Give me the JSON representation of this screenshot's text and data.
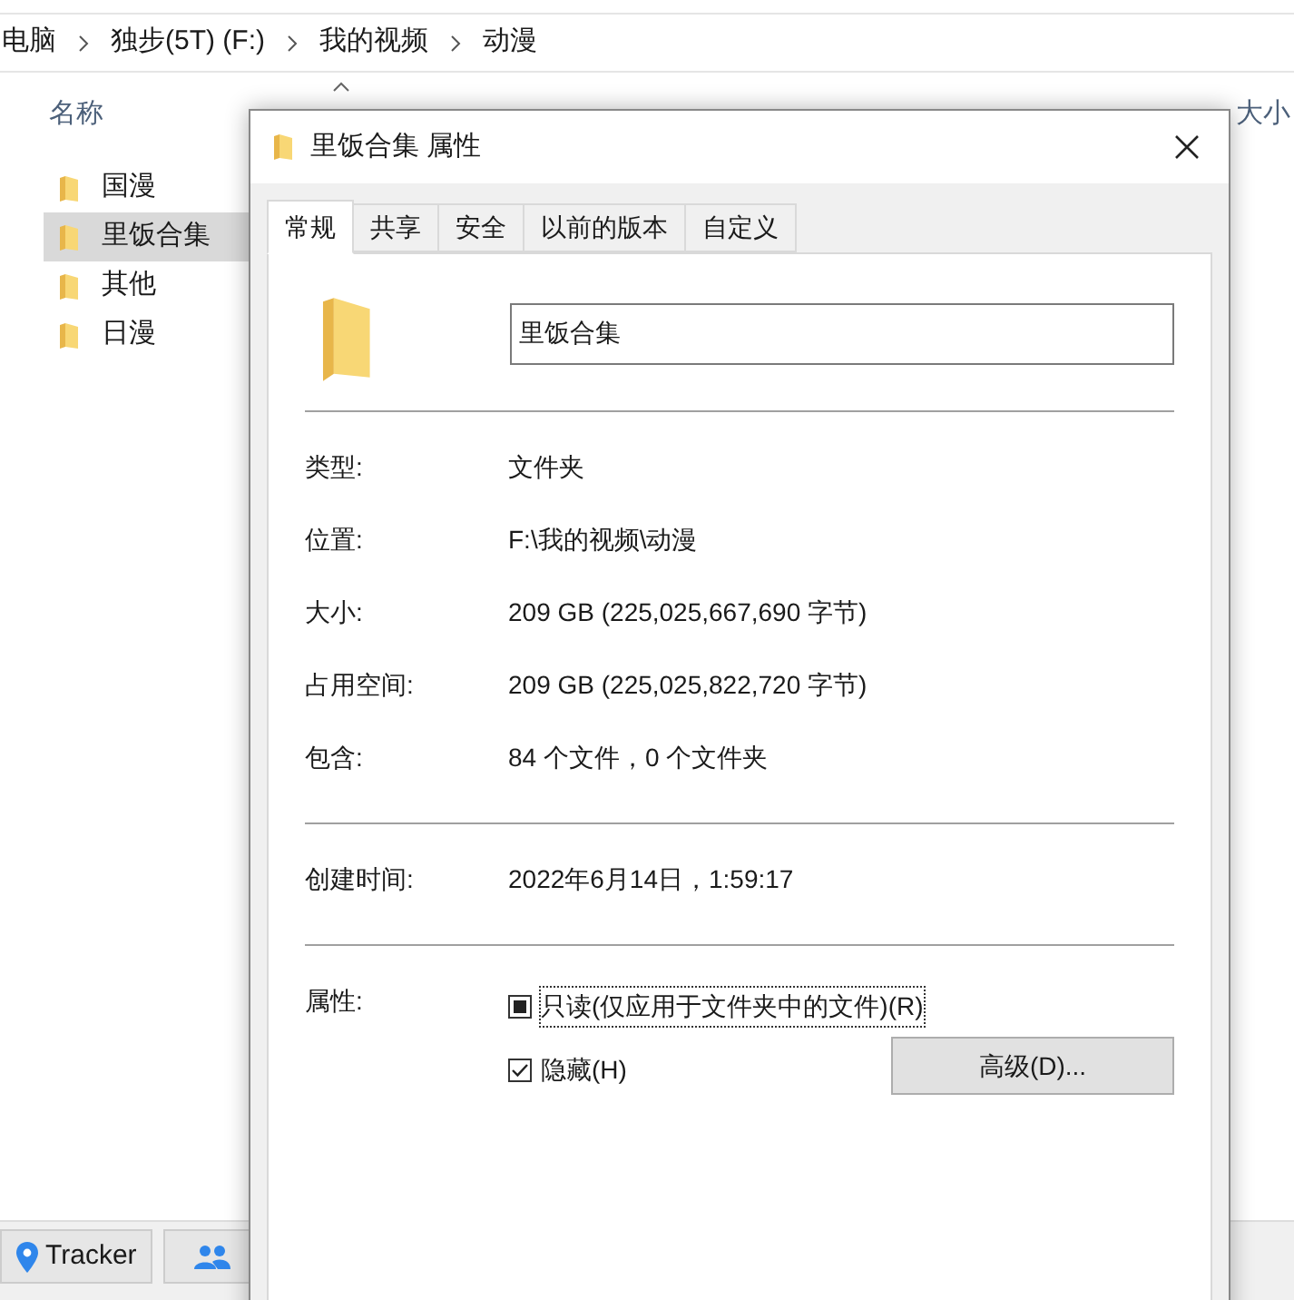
{
  "breadcrumb": [
    "电脑",
    "独步(5T) (F:)",
    "我的视频",
    "动漫"
  ],
  "columns": [
    {
      "label": "名称"
    },
    {
      "label": "大小"
    }
  ],
  "files": [
    {
      "name": "国漫",
      "selected": false
    },
    {
      "name": "里饭合集",
      "selected": true
    },
    {
      "name": "其他",
      "selected": false
    },
    {
      "name": "日漫",
      "selected": false
    }
  ],
  "taskbar": [
    {
      "kind": "pin",
      "label": "Tracker"
    },
    {
      "kind": "people"
    }
  ],
  "dialog": {
    "title": "里饭合集 属性",
    "tabs": [
      {
        "label": "常规",
        "selected": true
      },
      {
        "label": "共享",
        "selected": false
      },
      {
        "label": "安全",
        "selected": false
      },
      {
        "label": "以前的版本",
        "selected": false
      },
      {
        "label": "自定义",
        "selected": false
      }
    ],
    "name_value": "里饭合集",
    "groups": [
      [
        {
          "label": "类型:",
          "value": "文件夹"
        },
        {
          "label": "位置:",
          "value": "F:\\我的视频\\动漫"
        },
        {
          "label": "大小:",
          "value": "209 GB (225,025,667,690 字节)"
        },
        {
          "label": "占用空间:",
          "value": "209 GB (225,025,822,720 字节)"
        },
        {
          "label": "包含:",
          "value": "84 个文件，0 个文件夹"
        }
      ],
      [
        {
          "label": "创建时间:",
          "value": "2022年6月14日，1:59:17"
        }
      ]
    ],
    "attributes_label": "属性:",
    "attributes": [
      {
        "label": "只读(仅应用于文件夹中的文件)(R)",
        "checked": false,
        "indeterminate": true,
        "focused": true
      },
      {
        "label": "隐藏(H)",
        "checked": true,
        "indeterminate": false,
        "focused": false
      }
    ],
    "advanced_button": "高级(D)..."
  }
}
